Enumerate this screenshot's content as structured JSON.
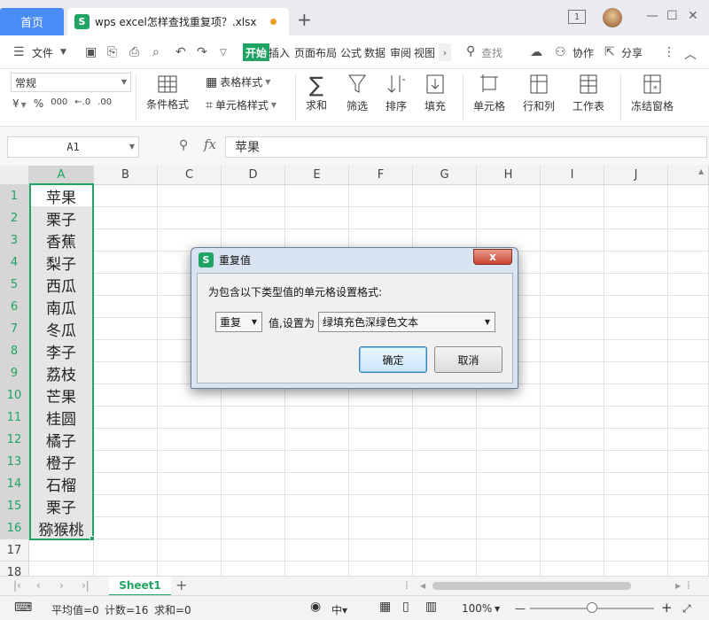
{
  "titlebar": {
    "home_tab": "首页",
    "file_tab": "wps excel怎样查找重复项？.xlsx",
    "new_tab_icon": "plus-icon",
    "tab_count": "1"
  },
  "menu": {
    "file": "文件",
    "start": "开始",
    "items": [
      "插入",
      "页面布局",
      "公式",
      "数据",
      "审阅",
      "视图"
    ],
    "search": "查找",
    "collab": "协作",
    "share": "分享"
  },
  "ribbon": {
    "number_format": "常规",
    "format_symbols": [
      "¥",
      "%",
      "000",
      "←.0",
      ".00"
    ],
    "cond_format": "条件格式",
    "table_style": "表格样式",
    "cell_style": "单元格样式",
    "sum": "求和",
    "filter": "筛选",
    "sort": "排序",
    "fill": "填充",
    "cell": "单元格",
    "rowcol": "行和列",
    "sheet": "工作表",
    "freeze": "冻结窗格"
  },
  "formula": {
    "name_box": "A1",
    "fx": "fx",
    "value": "苹果"
  },
  "grid": {
    "columns": [
      "A",
      "B",
      "C",
      "D",
      "E",
      "F",
      "G",
      "H",
      "I",
      "J"
    ],
    "rows": [
      "1",
      "2",
      "3",
      "4",
      "5",
      "6",
      "7",
      "8",
      "9",
      "10",
      "11",
      "12",
      "13",
      "14",
      "15",
      "16",
      "17",
      "18"
    ],
    "colA": [
      "苹果",
      "栗子",
      "香蕉",
      "梨子",
      "西瓜",
      "南瓜",
      "冬瓜",
      "李子",
      "荔枝",
      "芒果",
      "桂圆",
      "橘子",
      "橙子",
      "石榴",
      "栗子",
      "猕猴桃"
    ]
  },
  "sheets": {
    "active": "Sheet1"
  },
  "status": {
    "average": "平均值=0",
    "count": "计数=16",
    "sum": "求和=0",
    "zoom": "100%",
    "zoom_fraction": 0.5
  },
  "dialog": {
    "title": "重复值",
    "prompt": "为包含以下类型值的单元格设置格式:",
    "type_value": "重复",
    "mid_label": "值,设置为",
    "format_value": "绿填充色深绿色文本",
    "ok": "确定",
    "cancel": "取消",
    "close": "x"
  },
  "colors": {
    "accent": "#1fa463",
    "home_tab": "#4a8cf7",
    "dot": "#f29c1f"
  }
}
